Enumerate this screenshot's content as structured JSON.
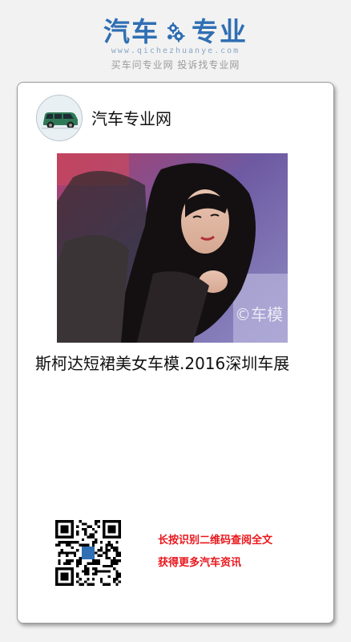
{
  "header": {
    "logo_left": "汽车",
    "logo_right": "专业",
    "logo_url": "www.qichezhuanye.com",
    "slogan": "买车问专业网 投诉找专业网"
  },
  "card": {
    "site_name": "汽车专业网",
    "photo_watermark": "©车模",
    "title": "斯柯达短裙美女车模.2016深圳车展",
    "cta_line1": "长按识别二维码查阅全文",
    "cta_line2": "获得更多汽车资讯"
  },
  "colors": {
    "brand_blue": "#2f6fb3",
    "cta_red": "#e8161b"
  },
  "icons": [
    "gear-icon",
    "car-avatar-icon",
    "qr-code"
  ]
}
